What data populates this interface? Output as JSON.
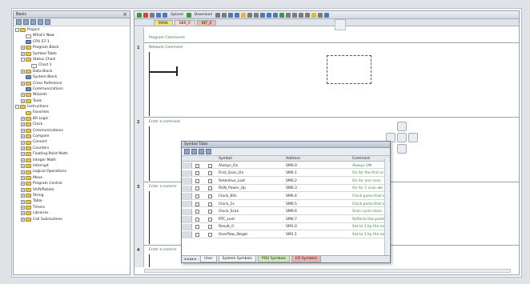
{
  "left_panel": {
    "title": "Basic",
    "tree": [
      {
        "label": "Project",
        "level": 0,
        "exp": "-",
        "icon": "folder"
      },
      {
        "label": "What's New",
        "level": 1,
        "exp": "",
        "icon": "doc"
      },
      {
        "label": "CPU S7-1",
        "level": 1,
        "exp": "",
        "icon": "item"
      },
      {
        "label": "Program Block",
        "level": 1,
        "exp": "+",
        "icon": "folder"
      },
      {
        "label": "Symbol Table",
        "level": 1,
        "exp": "+",
        "icon": "folder"
      },
      {
        "label": "Status Chart",
        "level": 1,
        "exp": "-",
        "icon": "folder"
      },
      {
        "label": "Chart 1",
        "level": 2,
        "exp": "",
        "icon": "doc"
      },
      {
        "label": "Data Block",
        "level": 1,
        "exp": "+",
        "icon": "folder"
      },
      {
        "label": "System Block",
        "level": 1,
        "exp": "",
        "icon": "item"
      },
      {
        "label": "Cross Reference",
        "level": 1,
        "exp": "+",
        "icon": "folder"
      },
      {
        "label": "Communications",
        "level": 1,
        "exp": "",
        "icon": "item"
      },
      {
        "label": "Wizards",
        "level": 1,
        "exp": "+",
        "icon": "folder"
      },
      {
        "label": "Tools",
        "level": 1,
        "exp": "+",
        "icon": "folder"
      },
      {
        "label": "Instructions",
        "level": 0,
        "exp": "-",
        "icon": "folder"
      },
      {
        "label": "Favorites",
        "level": 1,
        "exp": "",
        "icon": "folder"
      },
      {
        "label": "Bit Logic",
        "level": 1,
        "exp": "+",
        "icon": "folder"
      },
      {
        "label": "Clock",
        "level": 1,
        "exp": "+",
        "icon": "folder"
      },
      {
        "label": "Communications",
        "level": 1,
        "exp": "+",
        "icon": "folder"
      },
      {
        "label": "Compare",
        "level": 1,
        "exp": "+",
        "icon": "folder"
      },
      {
        "label": "Convert",
        "level": 1,
        "exp": "+",
        "icon": "folder"
      },
      {
        "label": "Counters",
        "level": 1,
        "exp": "+",
        "icon": "folder"
      },
      {
        "label": "Floating-Point Math",
        "level": 1,
        "exp": "+",
        "icon": "folder"
      },
      {
        "label": "Integer Math",
        "level": 1,
        "exp": "+",
        "icon": "folder"
      },
      {
        "label": "Interrupt",
        "level": 1,
        "exp": "+",
        "icon": "folder"
      },
      {
        "label": "Logical Operations",
        "level": 1,
        "exp": "+",
        "icon": "folder"
      },
      {
        "label": "Move",
        "level": 1,
        "exp": "+",
        "icon": "folder"
      },
      {
        "label": "Program Control",
        "level": 1,
        "exp": "+",
        "icon": "folder"
      },
      {
        "label": "Shift/Rotate",
        "level": 1,
        "exp": "+",
        "icon": "folder"
      },
      {
        "label": "String",
        "level": 1,
        "exp": "+",
        "icon": "folder"
      },
      {
        "label": "Table",
        "level": 1,
        "exp": "+",
        "icon": "folder"
      },
      {
        "label": "Timers",
        "level": 1,
        "exp": "+",
        "icon": "folder"
      },
      {
        "label": "Libraries",
        "level": 1,
        "exp": "+",
        "icon": "folder"
      },
      {
        "label": "Call Subroutines",
        "level": 1,
        "exp": "+",
        "icon": "folder"
      }
    ]
  },
  "toolbar": {
    "upload_label": "Upload",
    "download_label": "Download"
  },
  "editor_tabs": [
    "MAIN",
    "SBR_0",
    "INT_0"
  ],
  "ladder": {
    "program_comments": "Program Comments",
    "networks": [
      {
        "number": "1",
        "comment": "Network Comment"
      },
      {
        "number": "2",
        "comment": "Enter a comment"
      },
      {
        "number": "3",
        "comment": "Enter a comme"
      },
      {
        "number": "4",
        "comment": "Enter a comme"
      }
    ]
  },
  "symbol_table": {
    "title": "Symbol Table",
    "columns": [
      "Symbol",
      "Address",
      "Comment"
    ],
    "rows": [
      {
        "symbol": "Always_On",
        "address": "SM0.0",
        "comment": "Always ON"
      },
      {
        "symbol": "First_Scan_On",
        "address": "SM0.1",
        "comment": "On for the first sc"
      },
      {
        "symbol": "Retentive_Lost",
        "address": "SM0.2",
        "comment": "On for one scan"
      },
      {
        "symbol": "RUN_Power_Up",
        "address": "SM0.3",
        "comment": "On for 1 scan wh"
      },
      {
        "symbol": "Clock_60s",
        "address": "SM0.4",
        "comment": "Clock pulse that is"
      },
      {
        "symbol": "Clock_1s",
        "address": "SM0.5",
        "comment": "Clock pulse that is"
      },
      {
        "symbol": "Clock_Scan",
        "address": "SM0.6",
        "comment": "Scan cycle clock"
      },
      {
        "symbol": "RTC_Lost",
        "address": "SM0.7",
        "comment": "Reflects the positi"
      },
      {
        "symbol": "Result_0",
        "address": "SM1.0",
        "comment": "Set to 1 by the ex"
      },
      {
        "symbol": "Overflow_Illegal",
        "address": "SM1.1",
        "comment": "Set to 1 by the ex"
      }
    ],
    "bottom_tabs": [
      "User",
      "System Symbols",
      "POU Symbols",
      "I/O Symbols"
    ]
  }
}
